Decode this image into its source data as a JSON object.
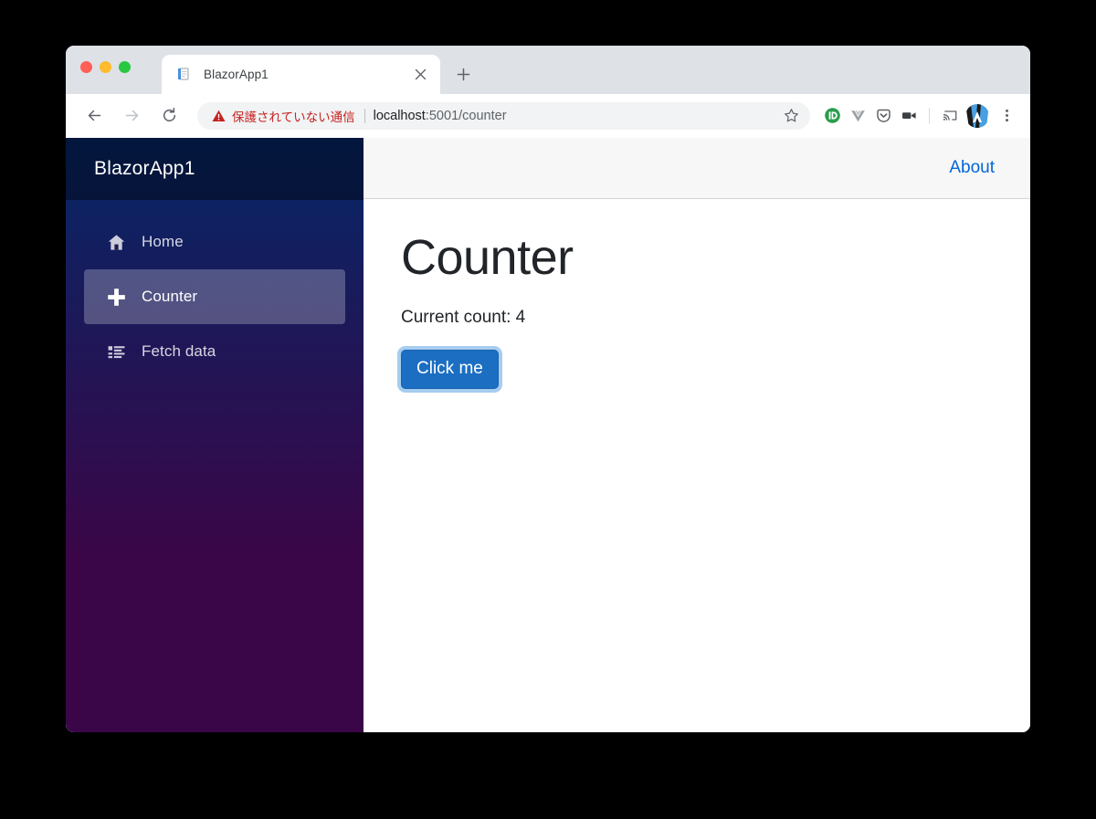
{
  "browser": {
    "window_controls": [
      {
        "name": "close",
        "color": "#ff5f57"
      },
      {
        "name": "minimize",
        "color": "#febc2e"
      },
      {
        "name": "maximize",
        "color": "#28c840"
      }
    ],
    "tabs": [
      {
        "title": "BlazorApp1",
        "favicon": "document-icon",
        "active": true
      }
    ],
    "new_tab_label": "+",
    "tab_close_label": "×",
    "nav": {
      "back_label": "←",
      "forward_label": "→",
      "reload_label": "↻"
    },
    "omnibox": {
      "security_text": "保護されていない通信",
      "security_icon": "warning-triangle-icon",
      "security_color": "#c5221f",
      "url_host": "localhost",
      "url_rest": ":5001/counter",
      "full_url": "localhost:5001/counter",
      "bookmark_icon": "star-icon"
    },
    "extensions": [
      {
        "name": "pushbullet-extension-icon",
        "color": "#2a9d4e"
      },
      {
        "name": "vue-devtools-extension-icon",
        "color": "#9aa0a6"
      },
      {
        "name": "pocket-extension-icon",
        "color": "#5f6368"
      },
      {
        "name": "screen-recorder-extension-icon",
        "color": "#3c4043"
      }
    ],
    "cast_icon": "cast-icon",
    "profile_avatar": "profile-avatar",
    "menu_icon": "three-dot-menu-icon"
  },
  "app": {
    "brand_title": "BlazorApp1",
    "nav_items": [
      {
        "label": "Home",
        "icon": "home-icon",
        "active": false
      },
      {
        "label": "Counter",
        "icon": "plus-icon",
        "active": true
      },
      {
        "label": "Fetch data",
        "icon": "list-icon",
        "active": false
      }
    ],
    "topbar": {
      "about_label": "About"
    },
    "content": {
      "heading": "Counter",
      "count_text": "Current count: 4",
      "count_value": "4",
      "button_label": "Click me"
    },
    "colors": {
      "sidebar_gradient_top": "#052767",
      "sidebar_gradient_bottom": "#3a0647",
      "button_primary": "#1b6ec2",
      "link_blue": "#0366d6"
    }
  }
}
